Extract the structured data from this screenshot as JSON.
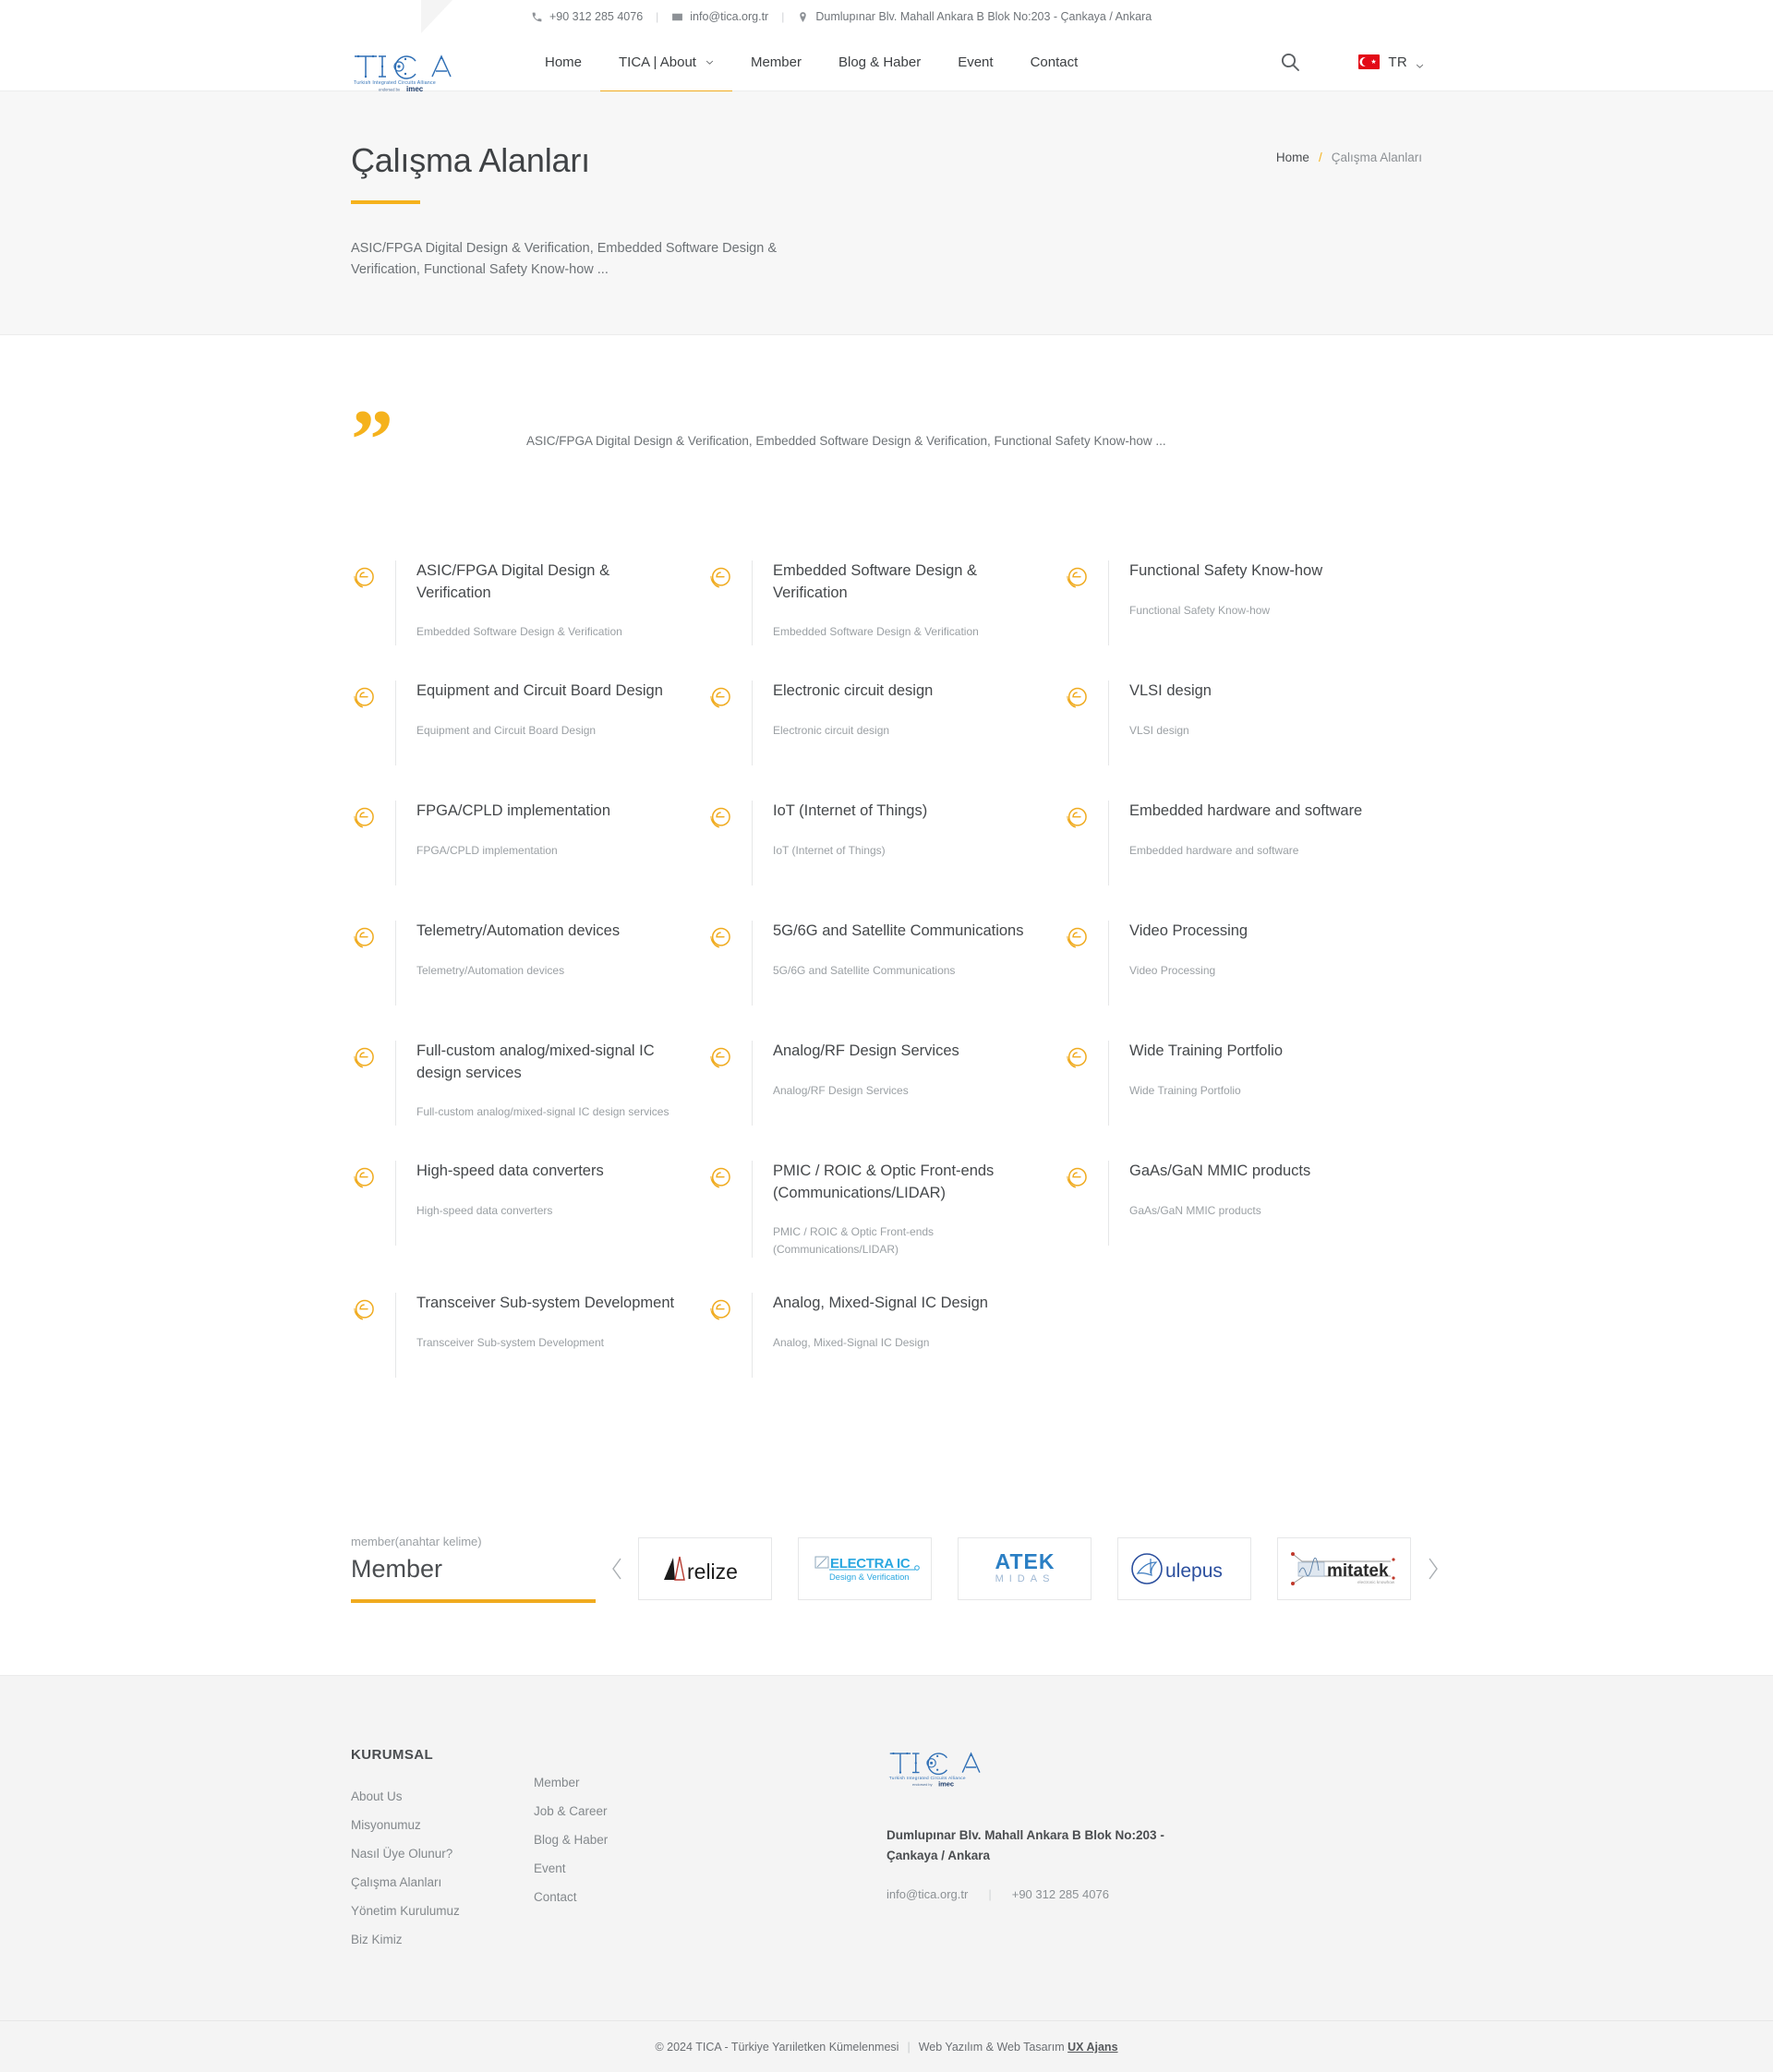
{
  "topbar": {
    "phone": "+90 312 285 4076",
    "email": "info@tica.org.tr",
    "address": "Dumlupınar Blv. Mahall Ankara B Blok No:203 - Çankaya / Ankara",
    "phone_icon": "phone-icon",
    "email_icon": "envelope-icon",
    "address_icon": "map-pin-icon"
  },
  "brand": {
    "logo_text": "TICA",
    "logo_tagline": "Turkish Integrated Circuits Alliance",
    "logo_endorsed": "endorsed by",
    "logo_partner": "imec"
  },
  "nav": {
    "items": [
      {
        "label": "Home",
        "active": false,
        "has_caret": false
      },
      {
        "label": "TICA | About",
        "active": true,
        "has_caret": true
      },
      {
        "label": "Member",
        "active": false,
        "has_caret": false
      },
      {
        "label": "Blog & Haber",
        "active": false,
        "has_caret": false
      },
      {
        "label": "Event",
        "active": false,
        "has_caret": false
      },
      {
        "label": "Contact",
        "active": false,
        "has_caret": false
      }
    ],
    "search_icon": "search-icon",
    "language": "TR",
    "language_caret_icon": "chevron-down-icon",
    "accent_color": "#f0ab1f"
  },
  "pagehead": {
    "title": "Çalışma Alanları",
    "description": "ASIC/FPGA Digital Design & Verification, Embedded Software Design & Verification, Functional Safety Know-how ...",
    "breadcrumb_home": "Home",
    "breadcrumb_sep": "/",
    "breadcrumb_current": "Çalışma Alanları"
  },
  "quote": {
    "mark": "”",
    "text": "ASIC/FPGA Digital Design & Verification, Embedded Software Design & Verification, Functional Safety Know-how ..."
  },
  "services": [
    {
      "title": "ASIC/FPGA Digital Design & Verification",
      "subtitle": "Embedded Software Design & Verification"
    },
    {
      "title": "Embedded Software Design & Verification",
      "subtitle": "Embedded Software Design & Verification"
    },
    {
      "title": "Functional Safety Know-how",
      "subtitle": "Functional Safety Know-how"
    },
    {
      "title": "Equipment and Circuit Board Design",
      "subtitle": "Equipment and Circuit Board Design"
    },
    {
      "title": "Electronic circuit design",
      "subtitle": "Electronic circuit design"
    },
    {
      "title": "VLSI design",
      "subtitle": "VLSI design"
    },
    {
      "title": "FPGA/CPLD implementation",
      "subtitle": "FPGA/CPLD implementation"
    },
    {
      "title": "IoT (Internet of Things)",
      "subtitle": "IoT (Internet of Things)"
    },
    {
      "title": "Embedded hardware and software",
      "subtitle": "Embedded hardware and software"
    },
    {
      "title": "Telemetry/Automation devices",
      "subtitle": "Telemetry/Automation devices"
    },
    {
      "title": "5G/6G and Satellite Communications",
      "subtitle": "5G/6G and Satellite Communications"
    },
    {
      "title": "Video Processing",
      "subtitle": "Video Processing"
    },
    {
      "title": "Full-custom analog/mixed-signal IC design services",
      "subtitle": "Full-custom analog/mixed-signal IC design services"
    },
    {
      "title": "Analog/RF Design Services",
      "subtitle": "Analog/RF Design Services"
    },
    {
      "title": "Wide Training Portfolio",
      "subtitle": "Wide Training Portfolio"
    },
    {
      "title": "High-speed data converters",
      "subtitle": "High-speed data converters"
    },
    {
      "title": "PMIC / ROIC & Optic Front-ends (Communications/LIDAR)",
      "subtitle": "PMIC / ROIC & Optic Front-ends (Communications/LIDAR)"
    },
    {
      "title": "GaAs/GaN MMIC products",
      "subtitle": "GaAs/GaN MMIC products"
    },
    {
      "title": "Transceiver Sub-system Development",
      "subtitle": "Transceiver Sub-system Development"
    },
    {
      "title": "Analog, Mixed-Signal IC Design",
      "subtitle": "Analog, Mixed-Signal IC Design"
    }
  ],
  "members": {
    "kicker": "member(anahtar kelime)",
    "title": "Member",
    "prev_icon": "chevron-left-icon",
    "next_icon": "chevron-right-icon",
    "logos": [
      {
        "name": "relize",
        "label": "relize"
      },
      {
        "name": "electra-ic",
        "label": "ELECTRA IC",
        "sublabel": "Design & Verification"
      },
      {
        "name": "atek-midas",
        "label": "ATEK",
        "sublabel": "M I D A S"
      },
      {
        "name": "ulepus",
        "label": "ulepus"
      },
      {
        "name": "mitatek",
        "label": "mitatek",
        "sublabel": "electronic known"
      }
    ]
  },
  "footer": {
    "heading": "KURUMSAL",
    "col1": [
      "About Us",
      "Misyonumuz",
      "Nasıl Üye Olunur?",
      "Çalışma Alanları",
      "Yönetim Kurulumuz",
      "Biz Kimiz"
    ],
    "col2": [
      "Member",
      "Job & Career",
      "Blog & Haber",
      "Event",
      "Contact"
    ],
    "address": "Dumlupınar Blv. Mahall Ankara B Blok No:203 - Çankaya / Ankara",
    "email": "info@tica.org.tr",
    "phone": "+90 312 285 4076"
  },
  "copyright": {
    "text": "© 2024 TICA - Türkiye Yarıiletken Kümelenmesi",
    "bar": "|",
    "credit": "Web Yazılım & Web Tasarım",
    "agency": "UX Ajans"
  }
}
